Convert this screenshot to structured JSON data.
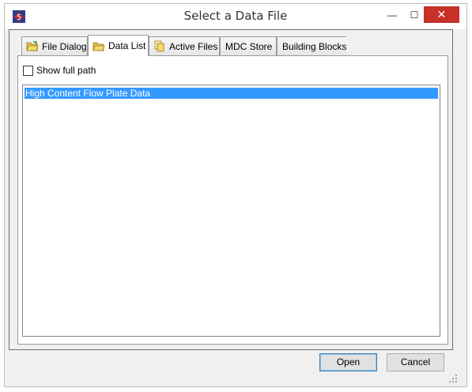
{
  "window": {
    "title": "Select a Data File",
    "controls": {
      "minimize": "—",
      "maximize": "☐",
      "close": "✕"
    }
  },
  "tabs": [
    {
      "label": "File Dialog",
      "icon": "folder-open-icon",
      "active": false
    },
    {
      "label": "Data List",
      "icon": "folder-open-icon",
      "active": true
    },
    {
      "label": "Active Files",
      "icon": "documents-icon",
      "active": false
    },
    {
      "label": "MDC Store",
      "icon": "",
      "active": false
    },
    {
      "label": "Building Blocks",
      "icon": "",
      "active": false
    }
  ],
  "options": {
    "show_full_path_label": "Show full path",
    "show_full_path_checked": false
  },
  "list": {
    "items": [
      {
        "label": "High Content Flow Plate Data",
        "selected": true
      }
    ]
  },
  "buttons": {
    "open": "Open",
    "cancel": "Cancel"
  },
  "colors": {
    "selection": "#3399ff",
    "close_button": "#c7312a",
    "app_icon": "#cc2222"
  }
}
